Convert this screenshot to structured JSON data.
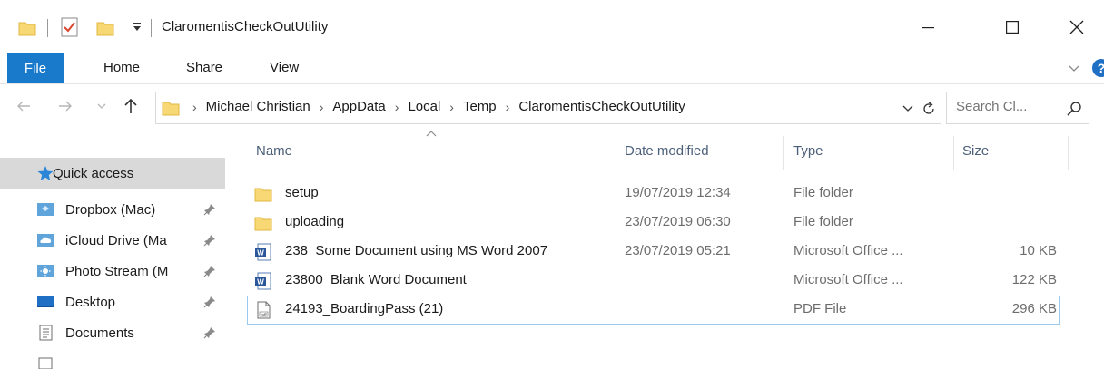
{
  "window": {
    "title": "ClaromentisCheckOutUtility",
    "minimize_label": "—",
    "maximize_label": "☐",
    "close_label": "✕"
  },
  "ribbon": {
    "tabs": [
      "File",
      "Home",
      "Share",
      "View"
    ]
  },
  "address": {
    "breadcrumbs": [
      "Michael Christian",
      "AppData",
      "Local",
      "Temp",
      "ClaromentisCheckOutUtility"
    ],
    "separator": "›"
  },
  "search": {
    "placeholder": "Search Cl..."
  },
  "nav_pane": {
    "items": [
      {
        "label": "Quick access",
        "icon": "star-icon",
        "pinned": false,
        "selected": true
      },
      {
        "label": "Dropbox (Mac)",
        "icon": "dropbox-folder-icon",
        "pinned": true,
        "selected": false
      },
      {
        "label": "iCloud Drive (Ma",
        "icon": "icloud-folder-icon",
        "pinned": true,
        "selected": false
      },
      {
        "label": "Photo Stream (M",
        "icon": "photostream-folder-icon",
        "pinned": true,
        "selected": false
      },
      {
        "label": "Desktop",
        "icon": "desktop-icon",
        "pinned": true,
        "selected": false
      },
      {
        "label": "Documents",
        "icon": "documents-icon",
        "pinned": true,
        "selected": false
      }
    ]
  },
  "file_list": {
    "columns": [
      "Name",
      "Date modified",
      "Type",
      "Size"
    ],
    "rows": [
      {
        "name": "setup",
        "date": "19/07/2019 12:34",
        "type": "File folder",
        "size": "",
        "icon": "folder-icon"
      },
      {
        "name": "uploading",
        "date": "23/07/2019 06:30",
        "type": "File folder",
        "size": "",
        "icon": "folder-icon"
      },
      {
        "name": "238_Some Document using MS Word 2007",
        "date": "23/07/2019 05:21",
        "type": "Microsoft Office ...",
        "size": "10 KB",
        "icon": "word-doc-icon"
      },
      {
        "name": "23800_Blank Word Document",
        "date": "",
        "type": "Microsoft Office ...",
        "size": "122 KB",
        "icon": "word-doc-icon"
      },
      {
        "name": "24193_BoardingPass (21)",
        "date": "",
        "type": "PDF File",
        "size": "296 KB",
        "icon": "pdf-file-icon"
      }
    ]
  },
  "colors": {
    "accent": "#1979ca",
    "folder": "#f8d775",
    "header_text": "#4c607a",
    "selection": "#d9d9d9",
    "focus_border": "#99c9ef"
  }
}
